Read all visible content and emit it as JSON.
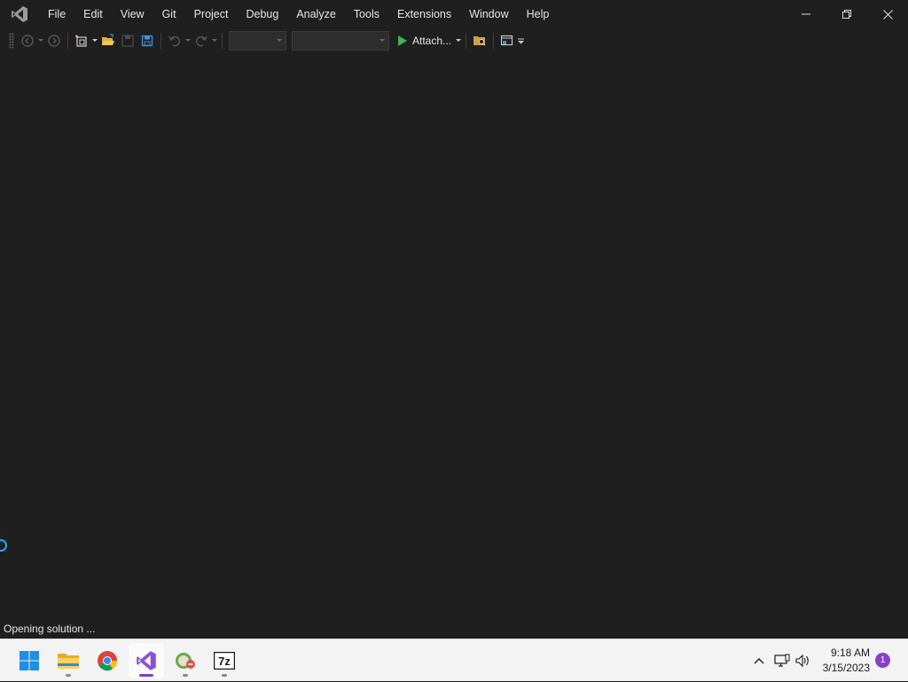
{
  "menu": {
    "items": [
      "File",
      "Edit",
      "View",
      "Git",
      "Project",
      "Debug",
      "Analyze",
      "Tools",
      "Extensions",
      "Window",
      "Help"
    ]
  },
  "toolbar": {
    "attach_label": "Attach...",
    "config_combo_value": "",
    "platform_combo_value": ""
  },
  "status": {
    "text": "Opening solution ..."
  },
  "taskbar": {
    "apps": [
      "start-icon",
      "file-explorer-icon",
      "chrome-icon",
      "visual-studio-icon",
      "app-icon",
      "7zip-icon"
    ],
    "active_app": "visual-studio-icon",
    "time": "9:18 AM",
    "date": "3/15/2023",
    "notification_count": "1"
  },
  "colors": {
    "background": "#1f1f1f",
    "accent": "#7a3fd1",
    "play": "#3fb54a",
    "spinner": "#2aa0ff",
    "taskbar": "#f3f3f3"
  }
}
